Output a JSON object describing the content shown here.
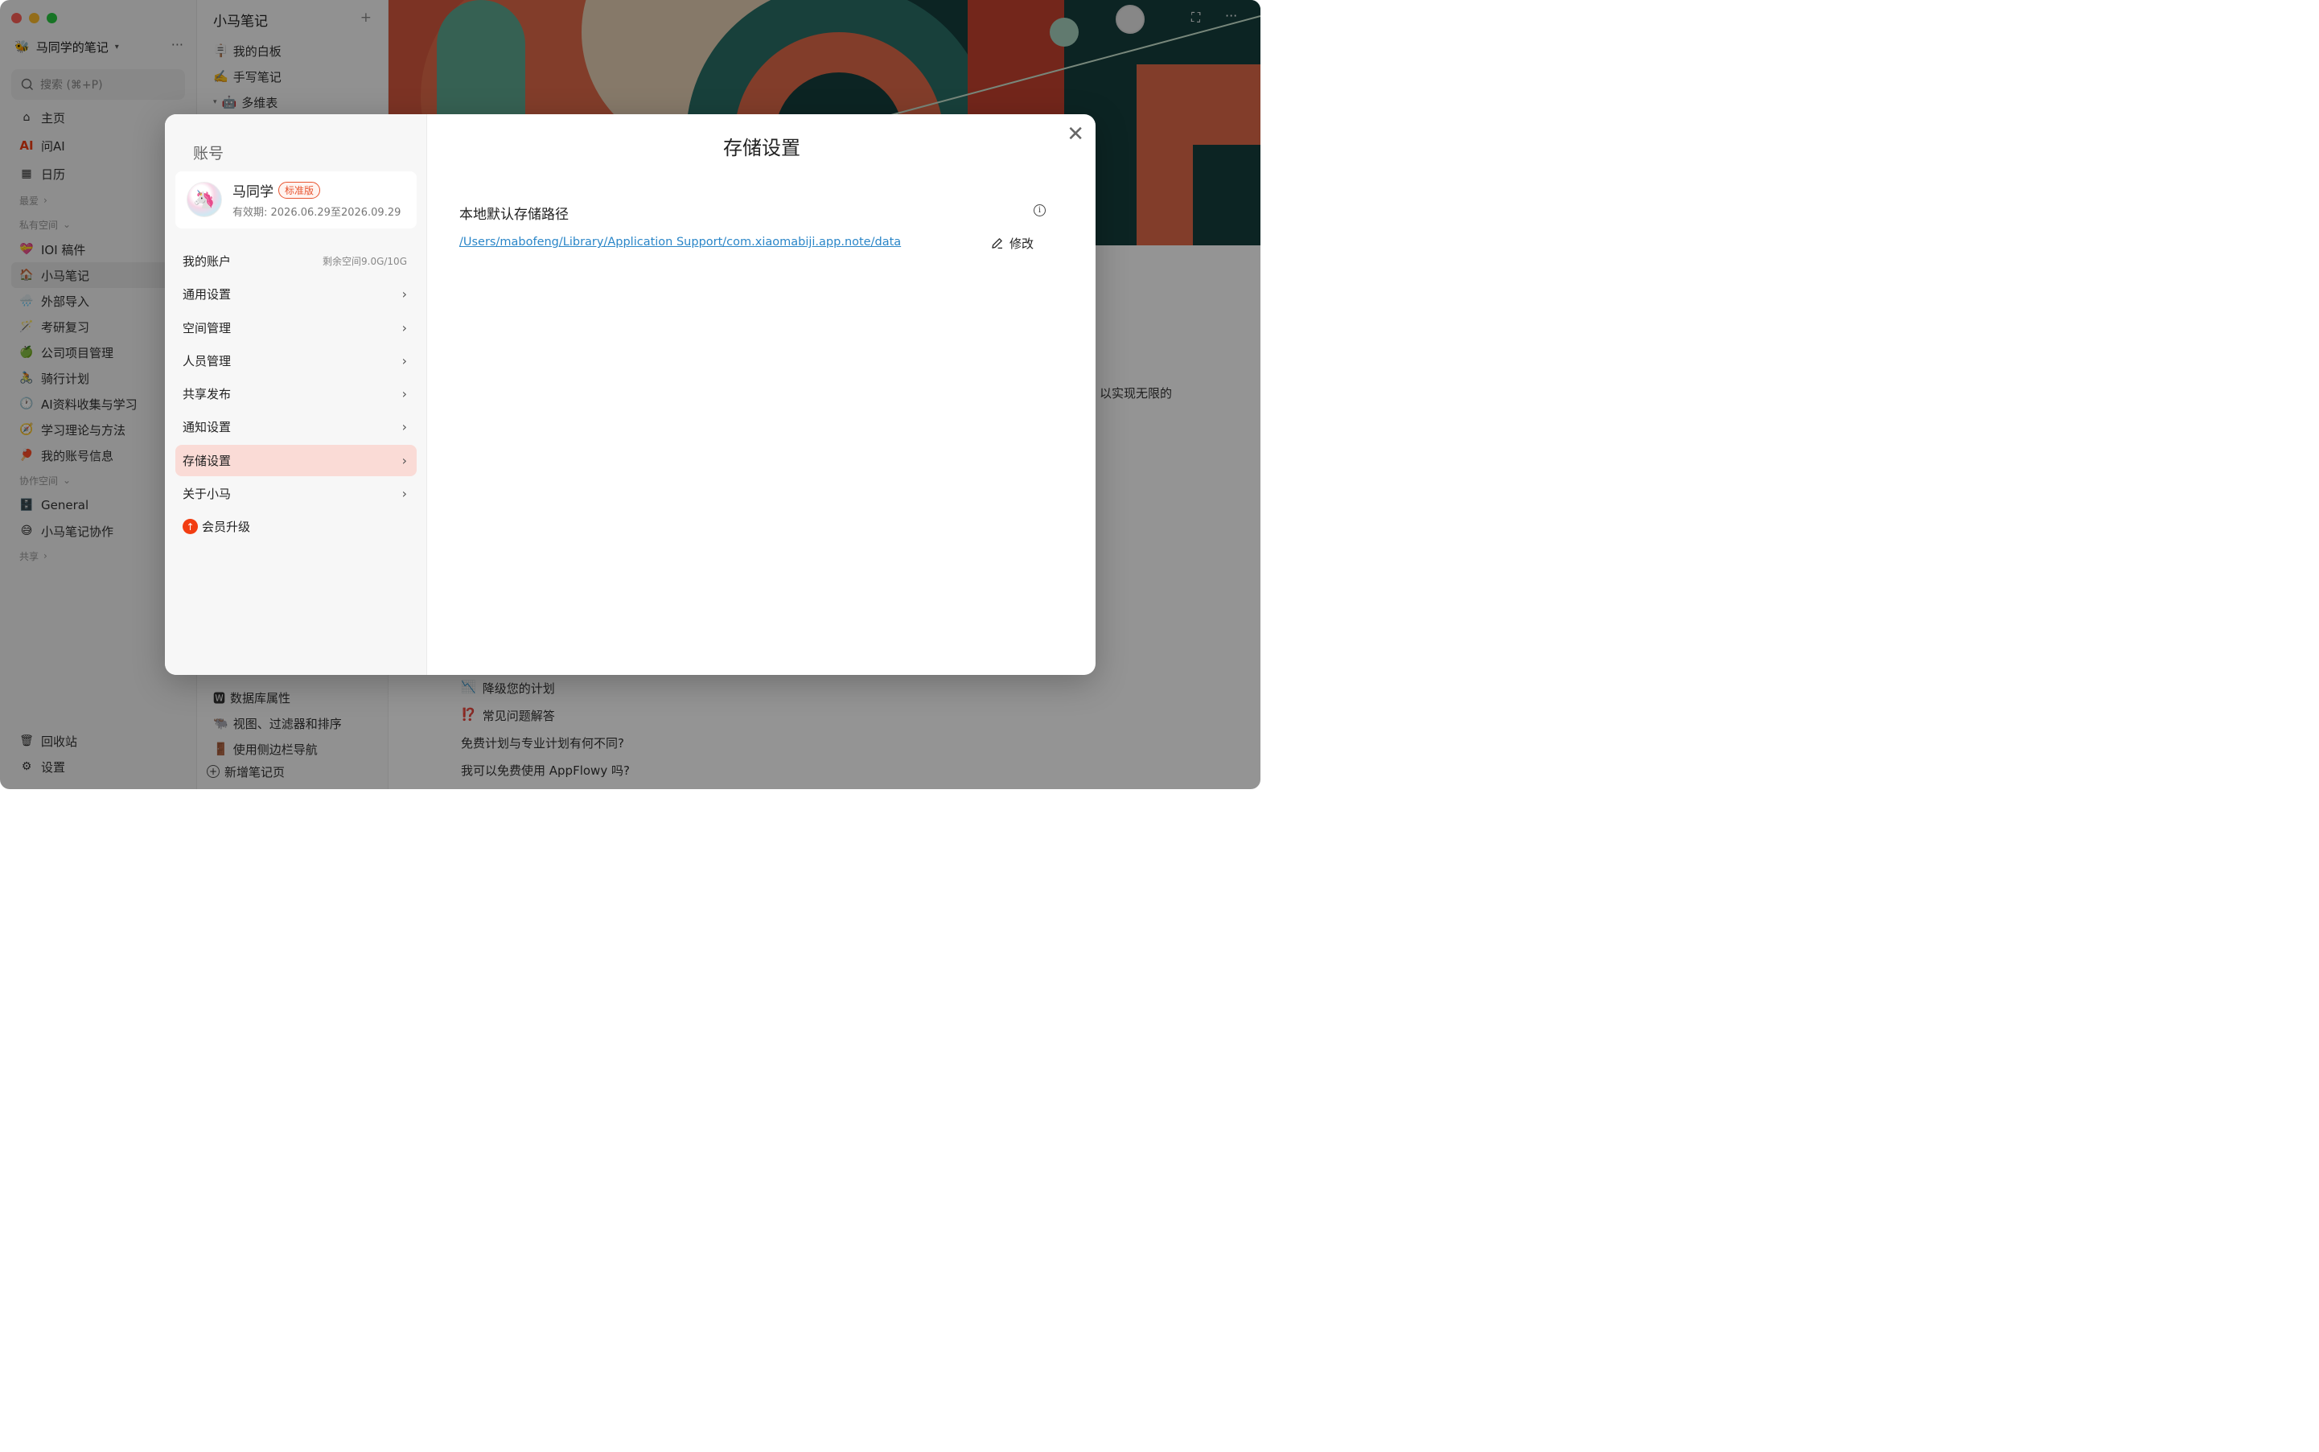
{
  "sidebar": {
    "workspace_name": "马同学的笔记",
    "search_placeholder": "搜索 (⌘+P)",
    "nav": [
      {
        "label": "主页"
      },
      {
        "label": "问AI"
      },
      {
        "label": "日历"
      }
    ],
    "favorites_label": "最爱",
    "private_label": "私有空间",
    "private_items": [
      {
        "icon": "💝",
        "label": "IOI 稿件"
      },
      {
        "icon": "🏠",
        "label": "小马笔记"
      },
      {
        "icon": "🌧️",
        "label": "外部导入"
      },
      {
        "icon": "🪄",
        "label": "考研复习"
      },
      {
        "icon": "🍏",
        "label": "公司项目管理"
      },
      {
        "icon": "🚴",
        "label": "骑行计划"
      },
      {
        "icon": "🕐",
        "label": "AI资料收集与学习"
      },
      {
        "icon": "🧭",
        "label": "学习理论与方法"
      },
      {
        "icon": "🏓",
        "label": "我的账号信息"
      }
    ],
    "collab_label": "协作空间",
    "collab_items": [
      {
        "icon": "🗄️",
        "label": "General"
      },
      {
        "icon": "😅",
        "label": "小马笔记协作"
      }
    ],
    "share_label": "共享",
    "trash_label": "回收站",
    "settings_label": "设置"
  },
  "tree": {
    "title": "小马笔记",
    "items_top": [
      {
        "icon": "🪧",
        "label": "我的白板"
      },
      {
        "icon": "✍️",
        "label": "手写笔记"
      },
      {
        "icon": "🤖",
        "label": "多维表"
      }
    ],
    "items_bottom": [
      {
        "icon": "🆆",
        "label": "数据库属性"
      },
      {
        "icon": "🐃",
        "label": "视图、过滤器和排序"
      },
      {
        "icon": "🚪",
        "label": "使用侧边栏导航"
      }
    ],
    "new_page_label": "新增笔记页"
  },
  "content": {
    "side_text": "以实现无限的",
    "items": [
      {
        "icon": "📉",
        "label": "降级您的计划"
      },
      {
        "icon": "⁉️",
        "label": "常见问题解答"
      },
      {
        "icon": "",
        "label": "免费计划与专业计划有何不同?"
      },
      {
        "icon": "",
        "label": "我可以免费使用 AppFlowy 吗?"
      }
    ]
  },
  "modal": {
    "left_title": "账号",
    "user": {
      "name": "马同学",
      "plan_badge": "标准版",
      "validity": "有效期: 2026.06.29至2026.09.29"
    },
    "menu": [
      {
        "label": "我的账户",
        "meta": "剩余空间9.0G/10G"
      },
      {
        "label": "通用设置"
      },
      {
        "label": "空间管理"
      },
      {
        "label": "人员管理"
      },
      {
        "label": "共享发布"
      },
      {
        "label": "通知设置"
      },
      {
        "label": "存储设置",
        "active": true
      },
      {
        "label": "关于小马"
      }
    ],
    "upgrade_label": "会员升级",
    "right_title": "存储设置",
    "section_label": "本地默认存储路径",
    "storage_path": "/Users/mabofeng/Library/Application Support/com.xiaomabiji.app.note/data",
    "edit_label": "修改"
  },
  "colors": {
    "accent": "#e8542f",
    "active_bg": "#fadbd6",
    "link": "#2a86c8",
    "upgrade": "#f23d12"
  }
}
